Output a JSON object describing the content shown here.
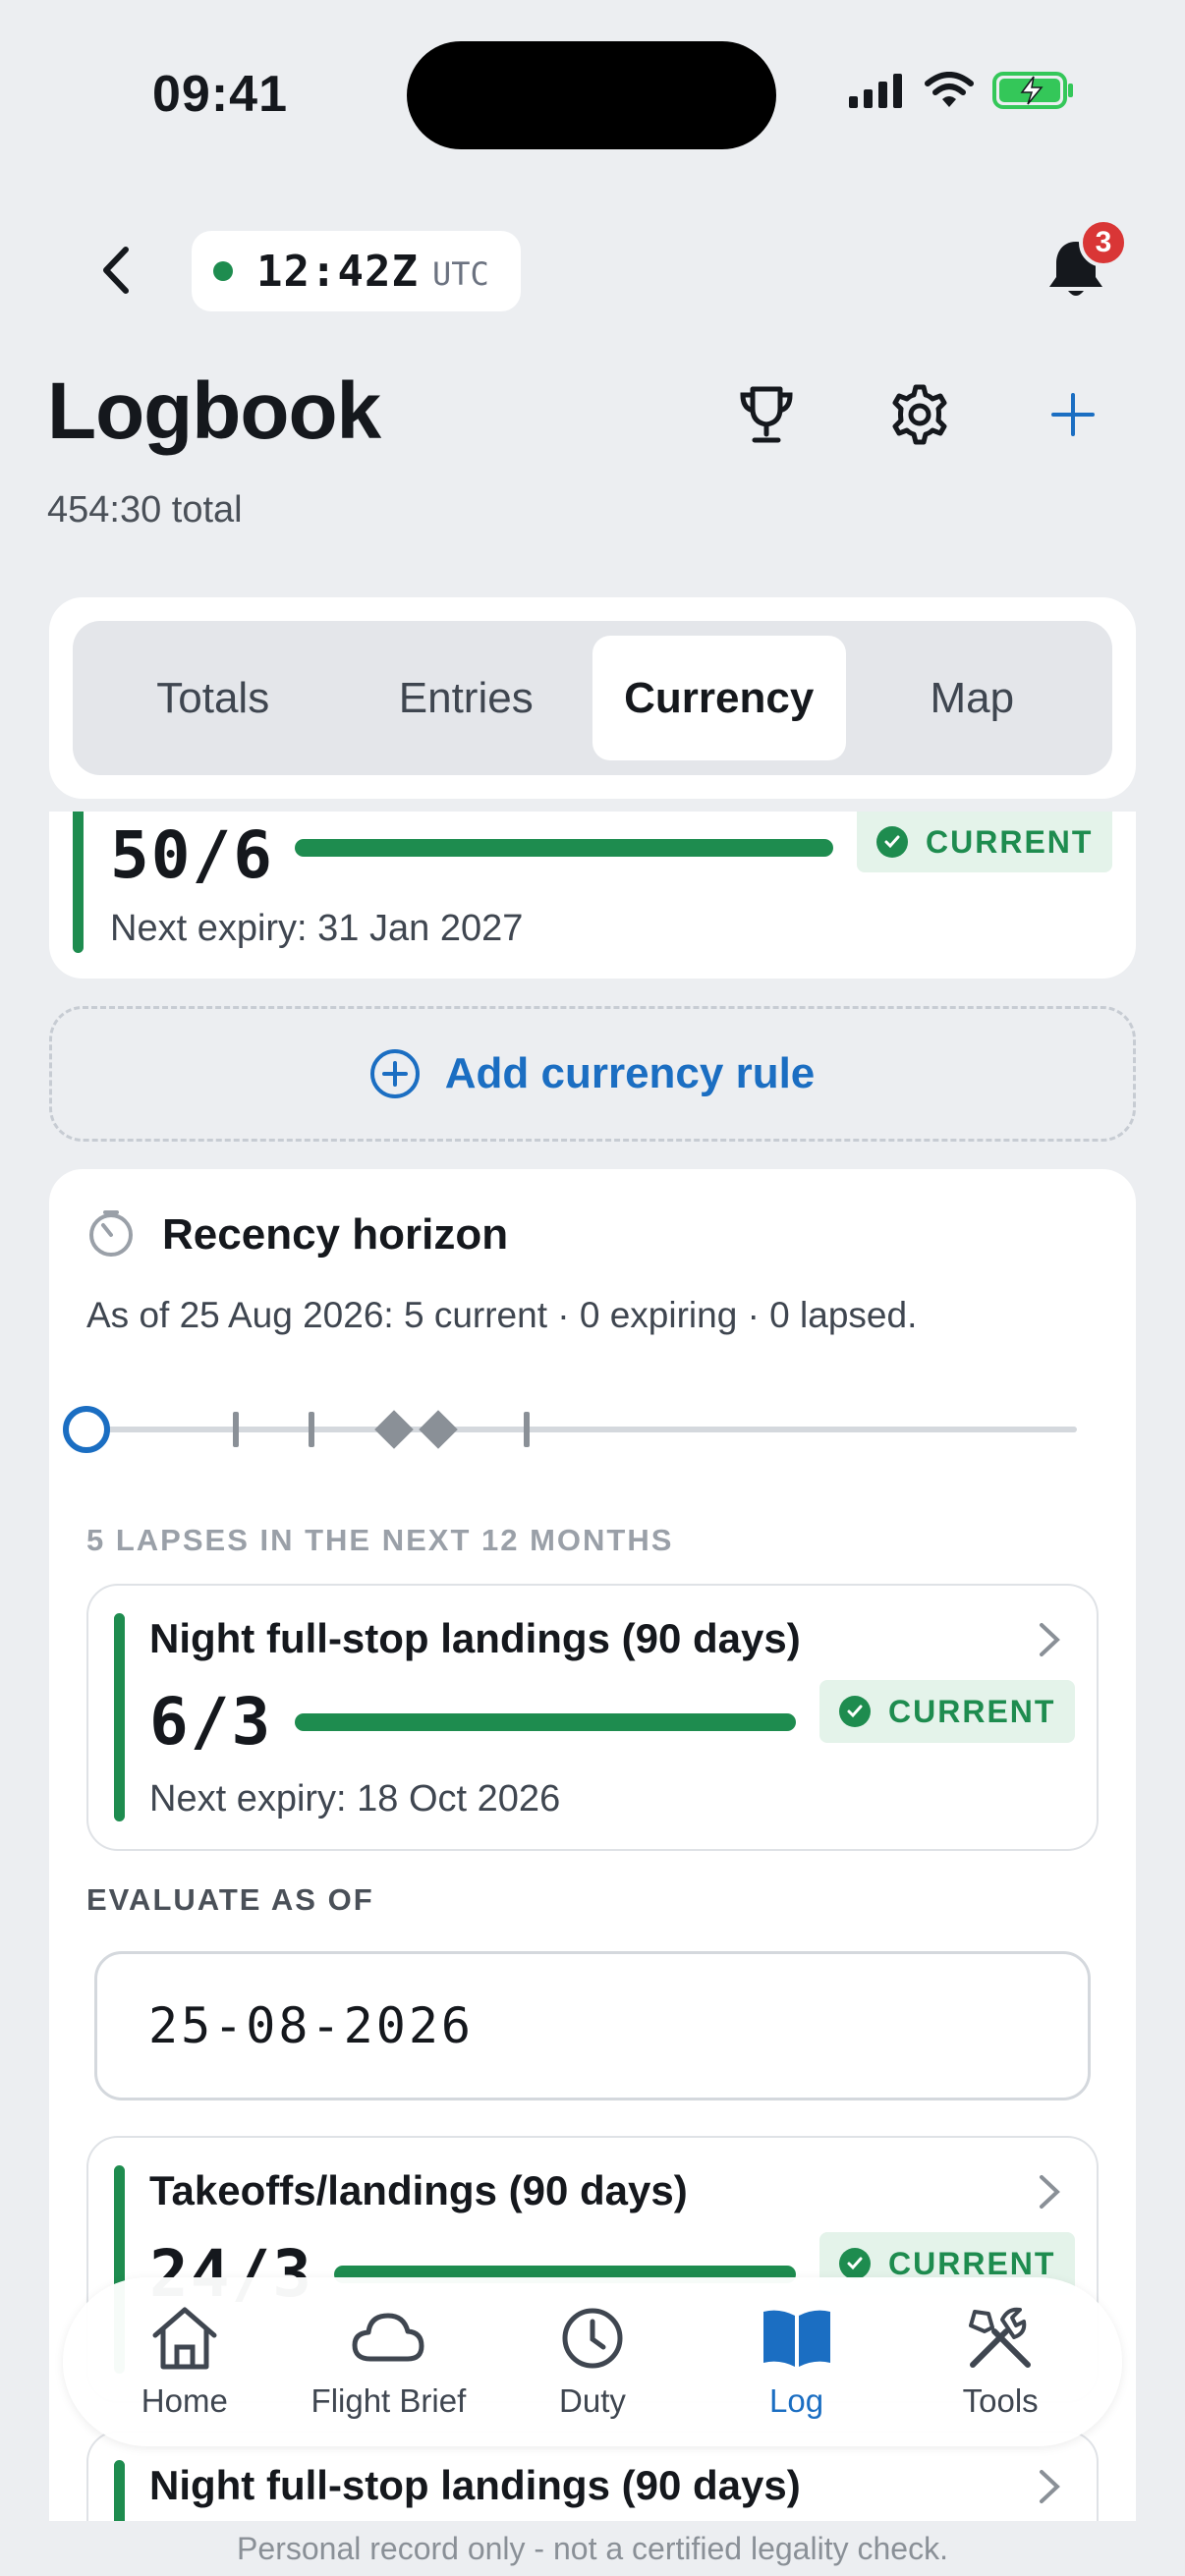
{
  "status_bar": {
    "time": "09:41"
  },
  "top_bar": {
    "utc_time": "12:42Z",
    "utc_label": "UTC",
    "notification_count": "3"
  },
  "header": {
    "title": "Logbook",
    "subtitle": "454:30 total"
  },
  "tabs": [
    {
      "label": "Totals",
      "active": false
    },
    {
      "label": "Entries",
      "active": false
    },
    {
      "label": "Currency",
      "active": true
    },
    {
      "label": "Map",
      "active": false
    }
  ],
  "partial_rule": {
    "value": "50/6",
    "status": "CURRENT",
    "expiry": "Next expiry: 31 Jan 2027"
  },
  "add_rule_label": "Add currency rule",
  "recency": {
    "title": "Recency horizon",
    "summary": "As of 25 Aug 2026: 5 current · 0 expiring · 0 lapsed.",
    "lapses_heading": "5 LAPSES IN THE NEXT 12 MONTHS",
    "first_rule": {
      "title": "Night full-stop landings (90 days)",
      "value": "6/3",
      "status": "CURRENT",
      "expiry": "Next expiry: 18 Oct 2026"
    },
    "evaluate_label": "EVALUATE AS OF",
    "evaluate_date": "25-08-2026",
    "second_rule": {
      "title": "Takeoffs/landings (90 days)",
      "value": "24/3",
      "status": "CURRENT"
    },
    "third_rule": {
      "title": "Night full-stop landings (90 days)"
    }
  },
  "bottom_nav": [
    {
      "label": "Home",
      "icon": "home-icon",
      "active": false
    },
    {
      "label": "Flight Brief",
      "icon": "cloud-icon",
      "active": false
    },
    {
      "label": "Duty",
      "icon": "clock-icon",
      "active": false
    },
    {
      "label": "Log",
      "icon": "book-icon",
      "active": true
    },
    {
      "label": "Tools",
      "icon": "tools-icon",
      "active": false
    }
  ],
  "disclaimer": "Personal record only - not a certified legality check.",
  "colors": {
    "accent": "#1b6ec2",
    "current_green": "#1e8c4f",
    "badge_red": "#d93636"
  }
}
